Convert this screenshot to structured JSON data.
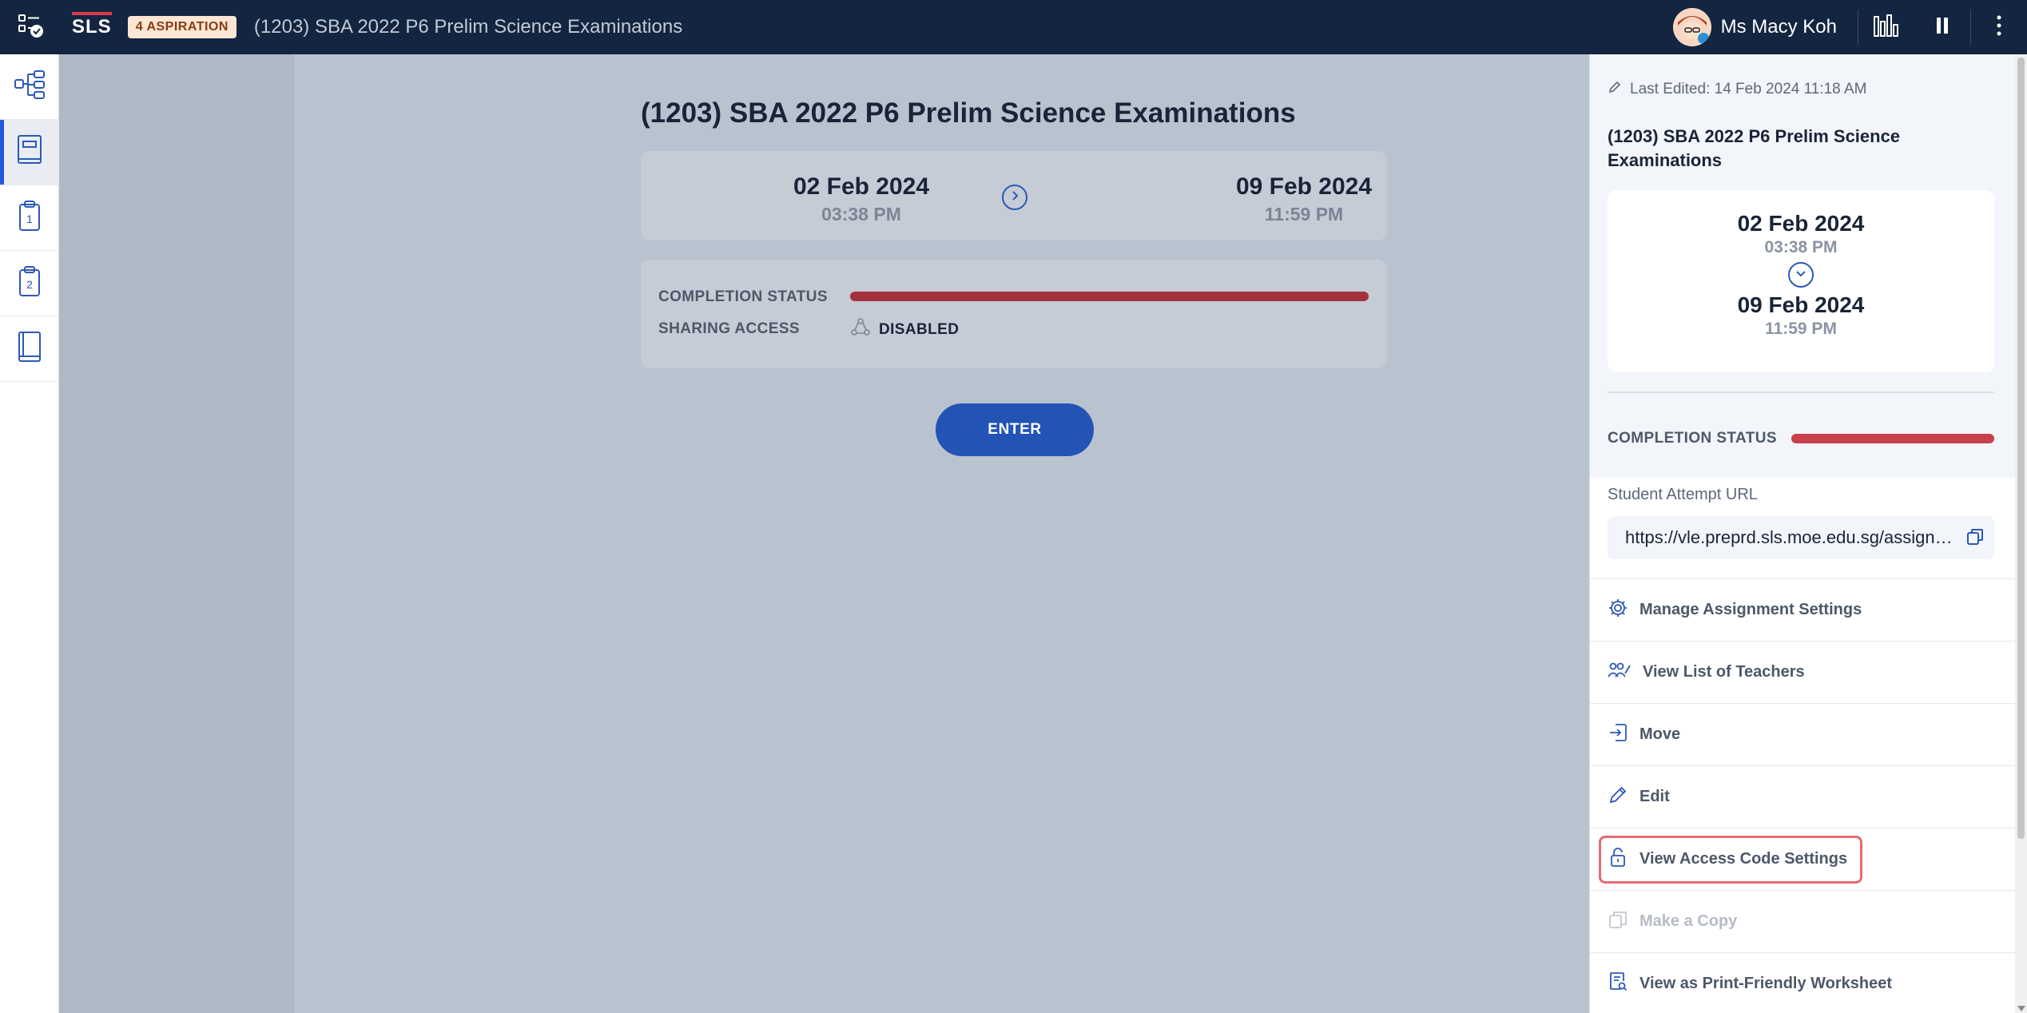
{
  "topbar": {
    "logo": "SLS",
    "badge": "4 ASPIRATION",
    "title": "(1203) SBA 2022 P6 Prelim Science Examinations",
    "user_name": "Ms Macy Koh"
  },
  "leftnav": {
    "items": [
      {
        "icon": "structure-icon"
      },
      {
        "icon": "book-icon",
        "active": true
      },
      {
        "icon": "clipboard-1-icon",
        "number": "1"
      },
      {
        "icon": "clipboard-2-icon",
        "number": "2"
      },
      {
        "icon": "book-closed-icon"
      }
    ]
  },
  "main": {
    "title": "(1203) SBA 2022 P6 Prelim Science Examinations",
    "start_date": "02 Feb 2024",
    "start_time": "03:38 PM",
    "end_date": "09 Feb 2024",
    "end_time": "11:59 PM",
    "completion_label": "COMPLETION STATUS",
    "sharing_label": "SHARING ACCESS",
    "sharing_value": "DISABLED",
    "enter_button": "ENTER"
  },
  "panel": {
    "last_edited": "Last Edited: 14 Feb 2024 11:18 AM",
    "title": "(1203) SBA 2022 P6 Prelim Science Examinations",
    "start_date": "02 Feb 2024",
    "start_time": "03:38 PM",
    "end_date": "09 Feb 2024",
    "end_time": "11:59 PM",
    "completion_label": "COMPLETION STATUS",
    "url_label": "Student Attempt URL",
    "url_value": "https://vle.preprd.sls.moe.edu.sg/assignment",
    "menu": [
      {
        "label": "Manage Assignment Settings",
        "icon": "gear-icon"
      },
      {
        "label": "View List of Teachers",
        "icon": "teachers-icon"
      },
      {
        "label": "Move",
        "icon": "move-icon"
      },
      {
        "label": "Edit",
        "icon": "pencil-icon"
      },
      {
        "label": "View Access Code Settings",
        "icon": "lock-icon",
        "highlighted": true
      },
      {
        "label": "Make a Copy",
        "icon": "copy-icon",
        "disabled": true
      },
      {
        "label": "View as Print-Friendly Worksheet",
        "icon": "worksheet-icon"
      }
    ]
  },
  "colors": {
    "topbar": "#132540",
    "accent": "#2353b5",
    "progress": "#a4323d",
    "highlight": "#e86a74"
  }
}
